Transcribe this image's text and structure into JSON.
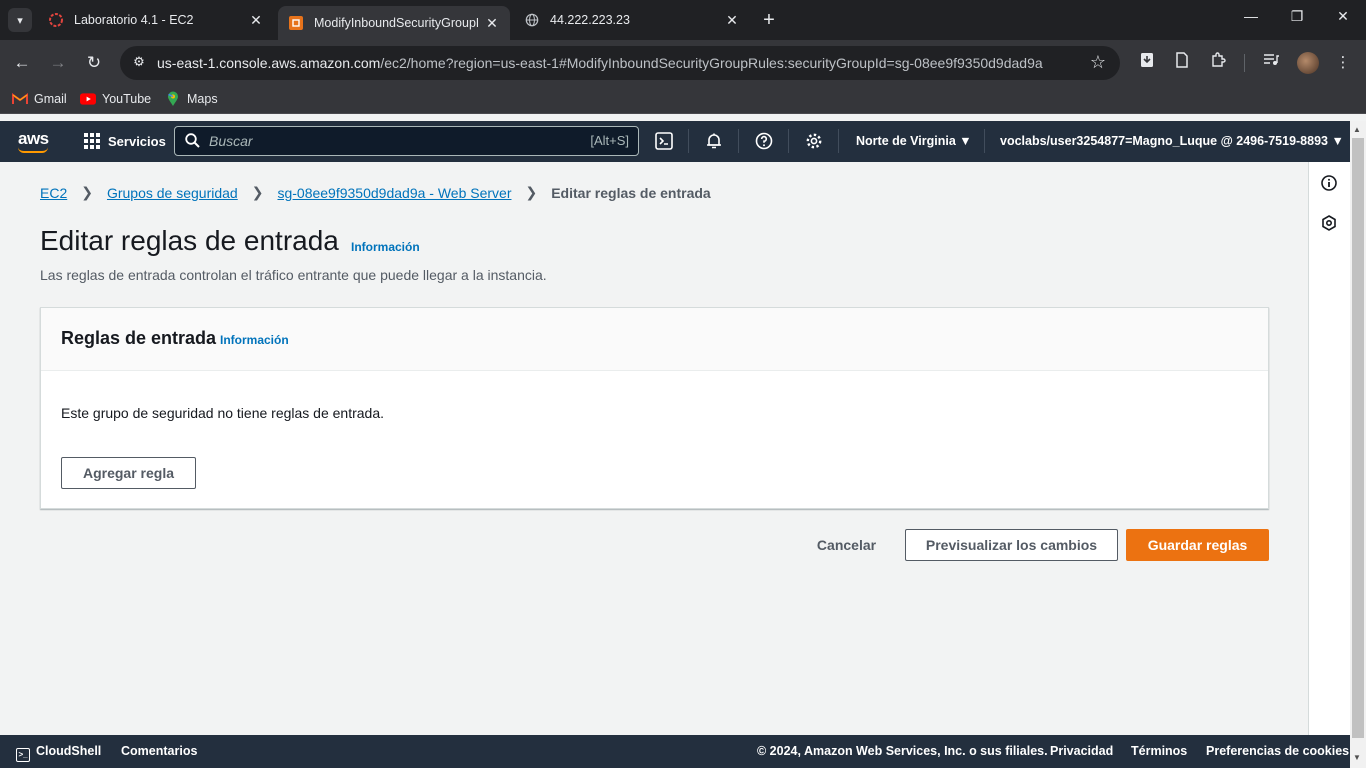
{
  "browser": {
    "tabs": [
      {
        "title": "Laboratorio 4.1 - EC2",
        "active": false
      },
      {
        "title": "ModifyInboundSecurityGroupRu",
        "active": true
      },
      {
        "title": "44.222.223.23",
        "active": false
      }
    ],
    "url_host": "us-east-1.console.aws.amazon.com",
    "url_path": "/ec2/home?region=us-east-1#ModifyInboundSecurityGroupRules:securityGroupId=sg-08ee9f9350d9dad9a",
    "bookmarks": [
      "Gmail",
      "YouTube",
      "Maps"
    ]
  },
  "aws_header": {
    "logo": "aws",
    "services_label": "Servicios",
    "search_placeholder": "Buscar",
    "search_shortcut": "[Alt+S]",
    "region": "Norte de Virginia",
    "account": "voclabs/user3254877=Magno_Luque @ 2496-7519-8893"
  },
  "breadcrumb": {
    "items": [
      "EC2",
      "Grupos de seguridad",
      "sg-08ee9f9350d9dad9a - Web Server"
    ],
    "current": "Editar reglas de entrada"
  },
  "page": {
    "title": "Editar reglas de entrada",
    "info_label": "Información",
    "description": "Las reglas de entrada controlan el tráfico entrante que puede llegar a la instancia."
  },
  "panel": {
    "title": "Reglas de entrada",
    "info_label": "Información",
    "empty_message": "Este grupo de seguridad no tiene reglas de entrada.",
    "add_rule_label": "Agregar regla"
  },
  "actions": {
    "cancel_label": "Cancelar",
    "preview_label": "Previsualizar los cambios",
    "save_label": "Guardar reglas"
  },
  "footer": {
    "cloudshell": "CloudShell",
    "feedback": "Comentarios",
    "copyright": "© 2024, Amazon Web Services, Inc. o sus filiales.",
    "privacy": "Privacidad",
    "terms": "Términos",
    "cookies": "Preferencias de cookies"
  },
  "colors": {
    "aws_nav": "#232f3e",
    "link": "#0073bb",
    "primary": "#ec7211",
    "browser_dark": "#202124"
  }
}
